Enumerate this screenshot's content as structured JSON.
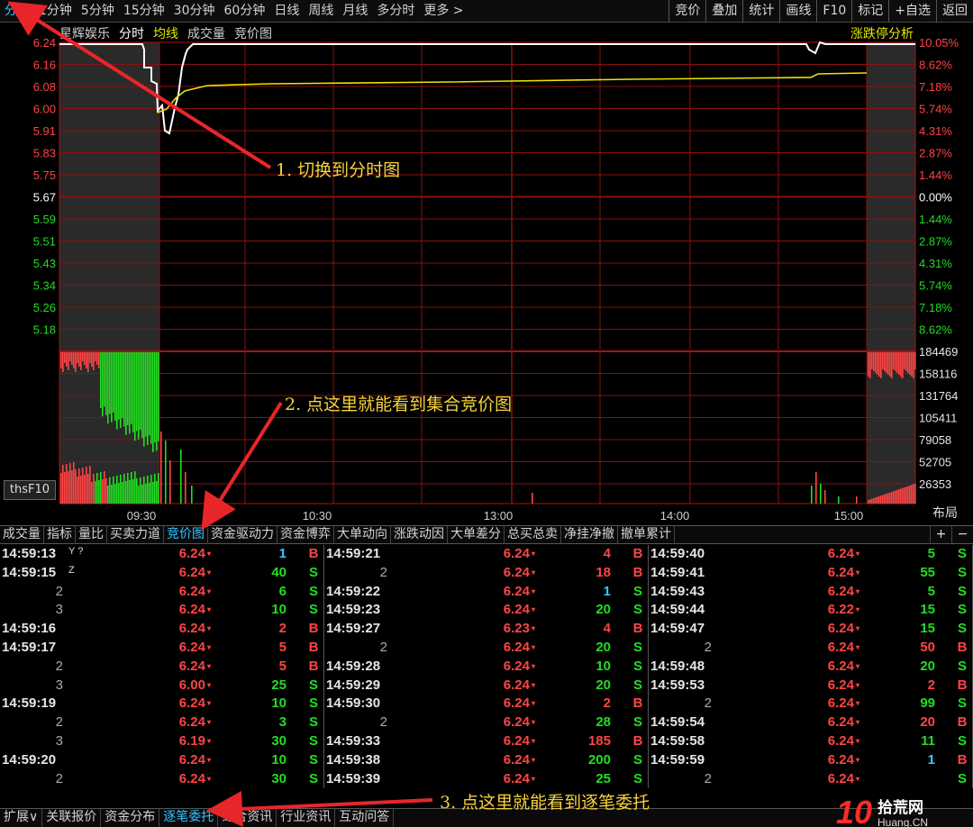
{
  "toolbar": {
    "period_tabs": [
      "分时",
      "1分钟",
      "5分钟",
      "15分钟",
      "30分钟",
      "60分钟",
      "日线",
      "周线",
      "月线",
      "多分时",
      "更多 >"
    ],
    "right_tools": [
      "竞价",
      "叠加",
      "统计",
      "画线",
      "F10",
      "标记",
      "+自选",
      "返回"
    ]
  },
  "chart": {
    "stock_name": "星辉娱乐",
    "mode_label": "分时",
    "avg_label": "均线",
    "volume_label": "成交量",
    "auction_label": "竞价图",
    "limit_tool": "涨跌停分析",
    "price_ticks": [
      "6.24",
      "6.16",
      "6.08",
      "6.00",
      "5.91",
      "5.83",
      "5.75",
      "5.67",
      "5.59",
      "5.51",
      "5.43",
      "5.34",
      "5.26",
      "5.18"
    ],
    "pct_ticks": [
      "10.05%",
      "8.62%",
      "7.18%",
      "5.74%",
      "4.31%",
      "2.87%",
      "1.44%",
      "0.00%",
      "1.44%",
      "2.87%",
      "4.31%",
      "5.74%",
      "7.18%",
      "8.62%"
    ],
    "volume_ticks": [
      "184469",
      "158116",
      "131764",
      "105411",
      "79058",
      "52705",
      "26353"
    ],
    "time_ticks": [
      "09:30",
      "10:30",
      "13:00",
      "14:00",
      "15:00"
    ],
    "thsf10": "thsF10",
    "layout_btn": "布局",
    "colors": {
      "up": "#ff4444",
      "down": "#22dd22",
      "price": "#ffffff",
      "avg": "#e6e600",
      "grid": "#8a1010",
      "accent": "#31c3ff"
    }
  },
  "indicator_tabs": [
    "成交量",
    "指标",
    "量比",
    "买卖力道",
    "竞价图",
    "资金驱动力",
    "资金博弈",
    "大单动向",
    "涨跌动因",
    "大单差分",
    "总买总卖",
    "净挂净撤",
    "撤单累计"
  ],
  "indicator_active": "竞价图",
  "plusminus": [
    "+",
    "−"
  ],
  "trades": [
    [
      {
        "t": "14:59:13",
        "mark": "Y ?",
        "p": "6.24",
        "pc": "red",
        "v": "1",
        "vc": "cyn",
        "d": "B"
      },
      {
        "t": "14:59:15",
        "mark": "Z",
        "p": "6.24",
        "pc": "red",
        "v": "40",
        "vc": "grn",
        "d": "S"
      },
      {
        "t": "2",
        "p": "6.24",
        "pc": "red",
        "v": "6",
        "vc": "grn",
        "d": "S"
      },
      {
        "t": "3",
        "p": "6.24",
        "pc": "red",
        "v": "10",
        "vc": "grn",
        "d": "S"
      },
      {
        "t": "14:59:16",
        "p": "6.24",
        "pc": "red",
        "v": "2",
        "vc": "red",
        "d": "B"
      },
      {
        "t": "14:59:17",
        "p": "6.24",
        "pc": "red",
        "v": "5",
        "vc": "red",
        "d": "B"
      },
      {
        "t": "2",
        "p": "6.24",
        "pc": "red",
        "v": "5",
        "vc": "red",
        "d": "B"
      },
      {
        "t": "3",
        "p": "6.00",
        "pc": "red",
        "v": "25",
        "vc": "grn",
        "d": "S"
      },
      {
        "t": "14:59:19",
        "p": "6.24",
        "pc": "red",
        "v": "10",
        "vc": "grn",
        "d": "S"
      },
      {
        "t": "2",
        "p": "6.24",
        "pc": "red",
        "v": "3",
        "vc": "grn",
        "d": "S"
      },
      {
        "t": "3",
        "p": "6.19",
        "pc": "red",
        "v": "30",
        "vc": "grn",
        "d": "S"
      },
      {
        "t": "14:59:20",
        "p": "6.24",
        "pc": "red",
        "v": "10",
        "vc": "grn",
        "d": "S"
      },
      {
        "t": "2",
        "p": "6.24",
        "pc": "red",
        "v": "30",
        "vc": "grn",
        "d": "S"
      }
    ],
    [
      {
        "t": "14:59:21",
        "p": "6.24",
        "pc": "red",
        "v": "4",
        "vc": "red",
        "d": "B"
      },
      {
        "t": "2",
        "p": "6.24",
        "pc": "red",
        "v": "18",
        "vc": "red",
        "d": "B"
      },
      {
        "t": "14:59:22",
        "p": "6.24",
        "pc": "red",
        "v": "1",
        "vc": "cyn",
        "d": "S"
      },
      {
        "t": "14:59:23",
        "p": "6.24",
        "pc": "red",
        "v": "20",
        "vc": "grn",
        "d": "S"
      },
      {
        "t": "14:59:27",
        "p": "6.23",
        "pc": "red",
        "v": "4",
        "vc": "red",
        "d": "B"
      },
      {
        "t": "2",
        "p": "6.24",
        "pc": "red",
        "v": "20",
        "vc": "grn",
        "d": "S"
      },
      {
        "t": "14:59:28",
        "p": "6.24",
        "pc": "red",
        "v": "10",
        "vc": "grn",
        "d": "S"
      },
      {
        "t": "14:59:29",
        "p": "6.24",
        "pc": "red",
        "v": "20",
        "vc": "grn",
        "d": "S"
      },
      {
        "t": "14:59:30",
        "p": "6.24",
        "pc": "red",
        "v": "2",
        "vc": "red",
        "d": "B"
      },
      {
        "t": "2",
        "p": "6.24",
        "pc": "red",
        "v": "28",
        "vc": "grn",
        "d": "S"
      },
      {
        "t": "14:59:33",
        "p": "6.24",
        "pc": "red",
        "v": "185",
        "vc": "red",
        "d": "B"
      },
      {
        "t": "14:59:38",
        "p": "6.24",
        "pc": "red",
        "v": "200",
        "vc": "grn",
        "d": "S"
      },
      {
        "t": "14:59:39",
        "p": "6.24",
        "pc": "red",
        "v": "25",
        "vc": "grn",
        "d": "S"
      }
    ],
    [
      {
        "t": "14:59:40",
        "p": "6.24",
        "pc": "red",
        "v": "5",
        "vc": "grn",
        "d": "S"
      },
      {
        "t": "14:59:41",
        "p": "6.24",
        "pc": "red",
        "v": "55",
        "vc": "grn",
        "d": "S"
      },
      {
        "t": "14:59:43",
        "p": "6.24",
        "pc": "red",
        "v": "5",
        "vc": "grn",
        "d": "S"
      },
      {
        "t": "14:59:44",
        "p": "6.22",
        "pc": "red",
        "v": "15",
        "vc": "grn",
        "d": "S"
      },
      {
        "t": "14:59:47",
        "p": "6.24",
        "pc": "red",
        "v": "15",
        "vc": "grn",
        "d": "S"
      },
      {
        "t": "2",
        "p": "6.24",
        "pc": "red",
        "v": "50",
        "vc": "red",
        "d": "B"
      },
      {
        "t": "14:59:48",
        "p": "6.24",
        "pc": "red",
        "v": "20",
        "vc": "grn",
        "d": "S"
      },
      {
        "t": "14:59:53",
        "p": "6.24",
        "pc": "red",
        "v": "2",
        "vc": "red",
        "d": "B"
      },
      {
        "t": "2",
        "p": "6.24",
        "pc": "red",
        "v": "99",
        "vc": "grn",
        "d": "S"
      },
      {
        "t": "14:59:54",
        "p": "6.24",
        "pc": "red",
        "v": "20",
        "vc": "red",
        "d": "B"
      },
      {
        "t": "14:59:58",
        "p": "6.24",
        "pc": "red",
        "v": "11",
        "vc": "grn",
        "d": "S"
      },
      {
        "t": "14:59:59",
        "p": "6.24",
        "pc": "red",
        "v": "1",
        "vc": "cyn",
        "d": "B"
      },
      {
        "t": "2",
        "p": "6.24",
        "pc": "red",
        "v": "",
        "vc": "grn",
        "d": "S"
      }
    ]
  ],
  "bottom_tabs": [
    "扩展∨",
    "关联报价",
    "资金分布",
    "逐笔委托",
    "综合资讯",
    "行业资讯",
    "互动问答"
  ],
  "bottom_active": "逐笔委托",
  "annotations": {
    "a1": "1. 切换到分时图",
    "a2": "2. 点这里就能看到集合竞价图",
    "a3": "3. 点这里就能看到逐笔委托"
  },
  "watermark": {
    "num": "10",
    "site": "拾荒网",
    "url": "Huang.CN"
  }
}
